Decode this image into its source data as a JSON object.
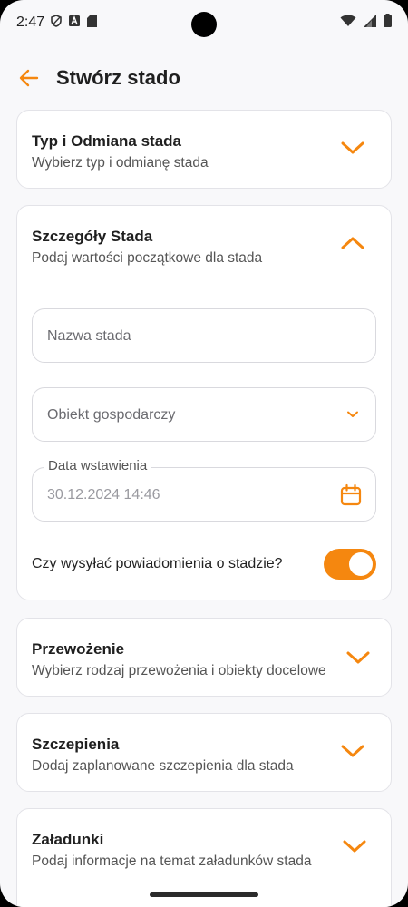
{
  "status_bar": {
    "time": "2:47"
  },
  "header": {
    "title": "Stwórz stado"
  },
  "accent_color": "#F5870F",
  "sections": [
    {
      "title": "Typ i Odmiana stada",
      "subtitle": "Wybierz typ i odmianę stada",
      "expanded": false
    },
    {
      "title": "Szczegóły Stada",
      "subtitle": "Podaj wartości początkowe dla stada",
      "expanded": true
    },
    {
      "title": "Przewożenie",
      "subtitle": "Wybierz rodzaj przewożenia i obiekty docelowe",
      "expanded": false
    },
    {
      "title": "Szczepienia",
      "subtitle": "Dodaj zaplanowane szczepienia dla stada",
      "expanded": false
    },
    {
      "title": "Załadunki",
      "subtitle": "Podaj informacje na temat załadunków stada",
      "expanded": false
    }
  ],
  "details_form": {
    "name_placeholder": "Nazwa stada",
    "facility_placeholder": "Obiekt gospodarczy",
    "date_label": "Data wstawienia",
    "date_value": "30.12.2024 14:46",
    "notify_label": "Czy wysyłać powiadomienia o stadzie?",
    "notify_enabled": true
  }
}
